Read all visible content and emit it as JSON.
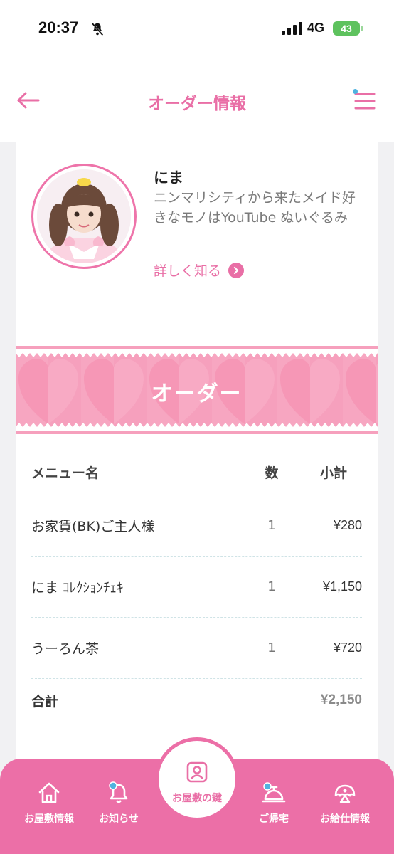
{
  "status_bar": {
    "time": "20:37",
    "network": "4G",
    "battery": "43"
  },
  "header": {
    "title": "オーダー情報"
  },
  "profile": {
    "name": "にま",
    "description": "ニンマリシティから来たメイド好きなモノはYouTube ぬいぐるみ",
    "more_link": "詳しく知る"
  },
  "banner": {
    "title": "オーダー"
  },
  "order_table": {
    "headers": {
      "name": "メニュー名",
      "qty": "数",
      "subtotal": "小計"
    },
    "rows": [
      {
        "name": "お家賃(BK)ご主人様",
        "qty": "1",
        "subtotal": "¥280"
      },
      {
        "name": "にま ｺﾚｸｼｮﾝﾁｪｷ",
        "qty": "1",
        "subtotal": "¥1,150"
      },
      {
        "name": "うーろん茶",
        "qty": "1",
        "subtotal": "¥720"
      }
    ],
    "total": {
      "label": "合計",
      "value": "¥2,150"
    }
  },
  "bottom_nav": {
    "items": [
      {
        "label": "お屋敷情報",
        "icon": "house-icon"
      },
      {
        "label": "お知らせ",
        "icon": "bell-icon"
      },
      {
        "label": "お屋敷の鍵",
        "icon": "key-card-icon"
      },
      {
        "label": "ご帰宅",
        "icon": "service-bell-icon"
      },
      {
        "label": "お給仕情報",
        "icon": "maid-headdress-icon"
      }
    ]
  },
  "colors": {
    "accent": "#e96fa6",
    "nav_bg": "#ec6fa7",
    "badge": "#4fb3e0"
  }
}
